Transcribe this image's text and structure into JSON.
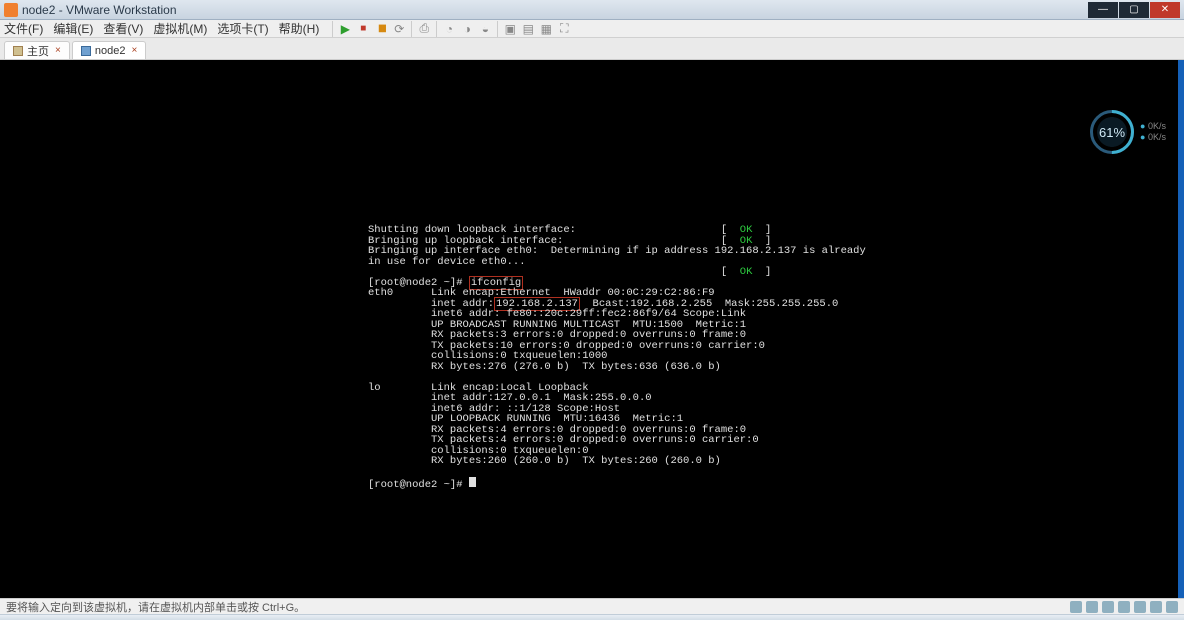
{
  "titlebar": {
    "title": "node2 - VMware Workstation"
  },
  "menu": {
    "file": "文件(F)",
    "edit": "编辑(E)",
    "view": "查看(V)",
    "vm": "虚拟机(M)",
    "tabs": "选项卡(T)",
    "help": "帮助(H)"
  },
  "tabs": {
    "home": "主页",
    "vm": "node2"
  },
  "hud": {
    "percent": "61%",
    "line1": "0K/s",
    "line2": "0K/s"
  },
  "console": {
    "l1a": "Shutting down loopback interface:",
    "l1b": "[  ",
    "l1ok": "OK",
    "l1c": "  ]",
    "l2a": "Bringing up loopback interface:",
    "l2ok": "OK",
    "l3": "Bringing up interface eth0:  Determining if ip address 192.168.2.137 is already",
    "l4": "in use for device eth0...",
    "l4ok": "OK",
    "p1a": "[root@node2 ~]# ",
    "p1cmd": "ifconfig",
    "e1": "eth0      Link encap:Ethernet  HWaddr 00:0C:29:C2:86:F9",
    "e2a": "          inet addr:",
    "e2ip": "192.168.2.137",
    "e2b": "  Bcast:192.168.2.255  Mask:255.255.255.0",
    "e3": "          inet6 addr: fe80::20c:29ff:fec2:86f9/64 Scope:Link",
    "e4": "          UP BROADCAST RUNNING MULTICAST  MTU:1500  Metric:1",
    "e5": "          RX packets:3 errors:0 dropped:0 overruns:0 frame:0",
    "e6": "          TX packets:10 errors:0 dropped:0 overruns:0 carrier:0",
    "e7": "          collisions:0 txqueuelen:1000",
    "e8": "          RX bytes:276 (276.0 b)  TX bytes:636 (636.0 b)",
    "lo1": "lo        Link encap:Local Loopback",
    "lo2": "          inet addr:127.0.0.1  Mask:255.0.0.0",
    "lo3": "          inet6 addr: ::1/128 Scope:Host",
    "lo4": "          UP LOOPBACK RUNNING  MTU:16436  Metric:1",
    "lo5": "          RX packets:4 errors:0 dropped:0 overruns:0 frame:0",
    "lo6": "          TX packets:4 errors:0 dropped:0 overruns:0 carrier:0",
    "lo7": "          collisions:0 txqueuelen:0",
    "lo8": "          RX bytes:260 (260.0 b)  TX bytes:260 (260.0 b)",
    "p2": "[root@node2 ~]# "
  },
  "statusbar": {
    "text": "要将输入定向到该虚拟机，请在虚拟机内部单击或按 Ctrl+G。"
  }
}
